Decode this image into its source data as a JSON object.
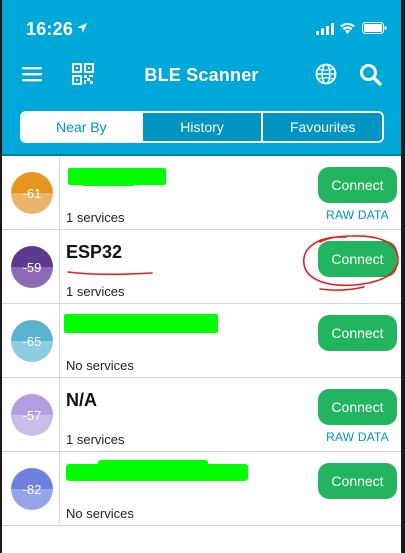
{
  "status_bar": {
    "time": "16:26",
    "icons": [
      "location-arrow-icon",
      "cellular-signal-icon",
      "wifi-icon",
      "battery-icon"
    ]
  },
  "header": {
    "title": "BLE Scanner",
    "icons": [
      "menu-icon",
      "qr-code-icon",
      "globe-icon",
      "search-icon"
    ]
  },
  "tabs": [
    {
      "label": "Near By",
      "active": true
    },
    {
      "label": "History",
      "active": false
    },
    {
      "label": "Favourites",
      "active": false
    }
  ],
  "devices": [
    {
      "rssi": "-61",
      "name": "",
      "services": "1 services",
      "connect_label": "Connect",
      "raw_data": "RAW DATA",
      "color_top": "#e6961e",
      "color_bottom": "#eab56b"
    },
    {
      "rssi": "-59",
      "name": "ESP32",
      "services": "1 services",
      "connect_label": "Connect",
      "raw_data": "",
      "color_top": "#5c3a8f",
      "color_bottom": "#8a6bb4"
    },
    {
      "rssi": "-65",
      "name": "",
      "services": "No services",
      "connect_label": "Connect",
      "raw_data": "",
      "color_top": "#5bb4cf",
      "color_bottom": "#8ccde0"
    },
    {
      "rssi": "-57",
      "name": "N/A",
      "services": "1 services",
      "connect_label": "Connect",
      "raw_data": "RAW DATA",
      "color_top": "#b39ee0",
      "color_bottom": "#cbbdea"
    },
    {
      "rssi": "-82",
      "name": "",
      "services": "No services",
      "connect_label": "Connect",
      "raw_data": "",
      "color_top": "#6e7fe0",
      "color_bottom": "#98a4ea"
    }
  ],
  "colors": {
    "brand": "#00a7d9",
    "connect": "#22b45e",
    "link": "#0094c2",
    "redaction": "#00ff00",
    "annotation": "#e02020"
  }
}
